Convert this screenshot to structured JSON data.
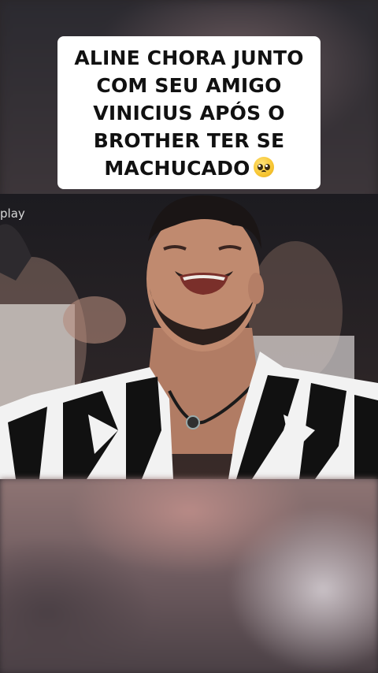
{
  "caption": {
    "line1": "ALINE CHORA JUNTO",
    "line2": "COM SEU AMIGO",
    "line3": "VINICIUS APÓS O",
    "line4": "BROTHER TER SE",
    "line5": "MACHUCADO",
    "emoji": "pleading-face-emoji"
  },
  "video": {
    "watermark": "play",
    "scene": "man-crying-in-patterned-shirt"
  },
  "colors": {
    "caption_bg": "#ffffff",
    "caption_text": "#111111",
    "shirt_black": "#111111",
    "shirt_white": "#f2f2f2"
  }
}
